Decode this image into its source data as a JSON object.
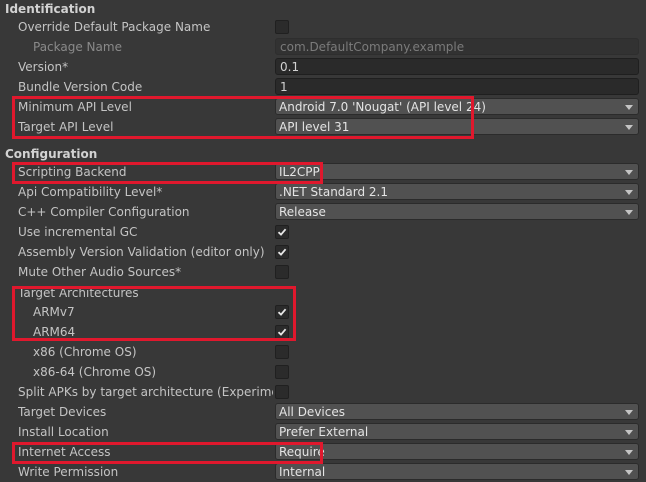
{
  "sections": {
    "identification": "Identification",
    "configuration": "Configuration"
  },
  "identification": {
    "override_default_package_name": {
      "label": "Override Default Package Name",
      "checked": false
    },
    "package_name": {
      "label": "Package Name",
      "value": "com.DefaultCompany.example"
    },
    "version": {
      "label": "Version*",
      "value": "0.1"
    },
    "bundle_version_code": {
      "label": "Bundle Version Code",
      "value": "1"
    },
    "minimum_api_level": {
      "label": "Minimum API Level",
      "value": "Android 7.0 'Nougat' (API level 24)"
    },
    "target_api_level": {
      "label": "Target API Level",
      "value": "API level 31"
    }
  },
  "configuration": {
    "scripting_backend": {
      "label": "Scripting Backend",
      "value": "IL2CPP"
    },
    "api_compatibility_level": {
      "label": "Api Compatibility Level*",
      "value": ".NET Standard 2.1"
    },
    "cpp_compiler_configuration": {
      "label": "C++ Compiler Configuration",
      "value": "Release"
    },
    "use_incremental_gc": {
      "label": "Use incremental GC",
      "checked": true
    },
    "assembly_version_validation": {
      "label": "Assembly Version Validation (editor only)",
      "checked": true
    },
    "mute_other_audio_sources": {
      "label": "Mute Other Audio Sources*",
      "checked": false
    },
    "target_architectures": {
      "label": "Target Architectures"
    },
    "armv7": {
      "label": "ARMv7",
      "checked": true
    },
    "arm64": {
      "label": "ARM64",
      "checked": true
    },
    "x86_chrome_os": {
      "label": "x86 (Chrome OS)",
      "checked": false
    },
    "x86_64_chrome_os": {
      "label": "x86-64 (Chrome OS)",
      "checked": false
    },
    "split_apks": {
      "label": "Split APKs by target architecture (Experimental)",
      "checked": false
    },
    "target_devices": {
      "label": "Target Devices",
      "value": "All Devices"
    },
    "install_location": {
      "label": "Install Location",
      "value": "Prefer External"
    },
    "internet_access": {
      "label": "Internet Access",
      "value": "Require"
    },
    "write_permission": {
      "label": "Write Permission",
      "value": "Internal"
    }
  },
  "colors": {
    "background": "#383838",
    "highlight": "#e0182d",
    "dropdown": "#515151",
    "text_field": "#2a2a2a"
  }
}
